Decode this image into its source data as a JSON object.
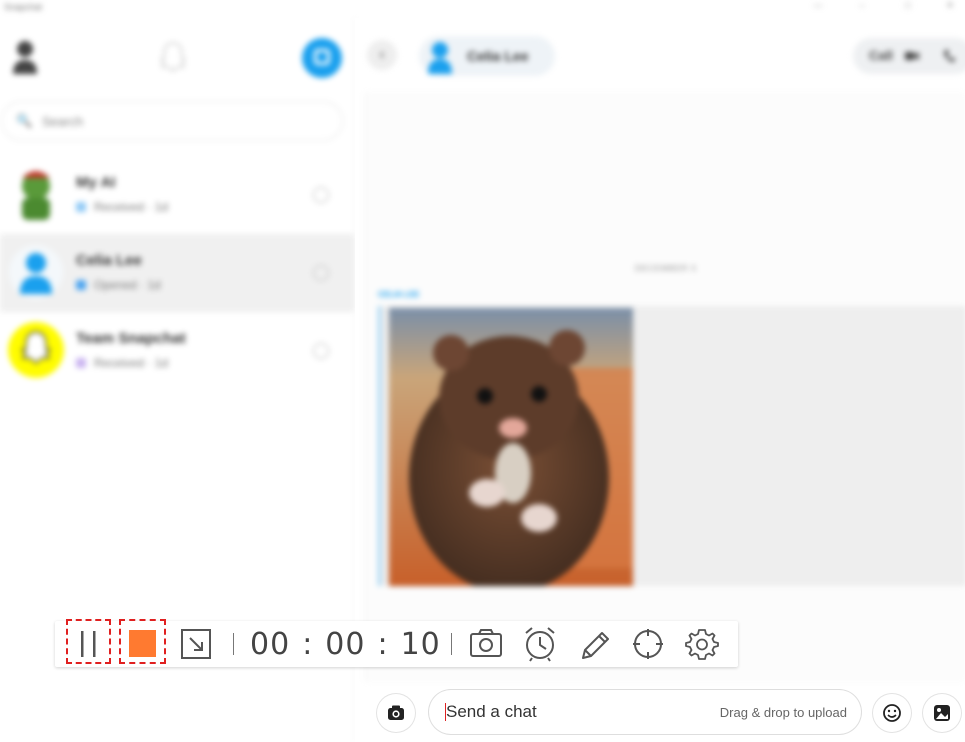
{
  "window": {
    "title": "Snapchat",
    "controls": [
      "—",
      "–",
      "□",
      "✕"
    ]
  },
  "sidebar": {
    "search_placeholder": "Search",
    "conversations": [
      {
        "name": "My AI",
        "status": "Received · 1d",
        "status_color": "#8fc9f5",
        "avatar": "bitmoji-green"
      },
      {
        "name": "Celia Lee",
        "status": "Opened · 1d",
        "status_color": "#4aa3f0",
        "avatar": "default-blue",
        "selected": true
      },
      {
        "name": "Team Snapchat",
        "status": "Received · 1d",
        "status_color": "#c9b3f0",
        "avatar": "snapchat-ghost"
      }
    ]
  },
  "chat": {
    "contact_name": "Celia Lee",
    "call_label": "Call",
    "date_separator": "DECEMBER 5",
    "from_label": "CELIA LEE",
    "photo": "hamster-photo",
    "input_placeholder": "Send a chat",
    "drag_drop_hint": "Drag & drop to upload"
  },
  "recorder": {
    "timer": {
      "hours": "00",
      "minutes": "00",
      "seconds": "10"
    },
    "colors": {
      "stop": "#ff7a30",
      "highlight": "#e02020",
      "icon": "#555555"
    }
  },
  "colors": {
    "accent": "#1aa0ee",
    "snap_yellow": "#fffc00"
  }
}
